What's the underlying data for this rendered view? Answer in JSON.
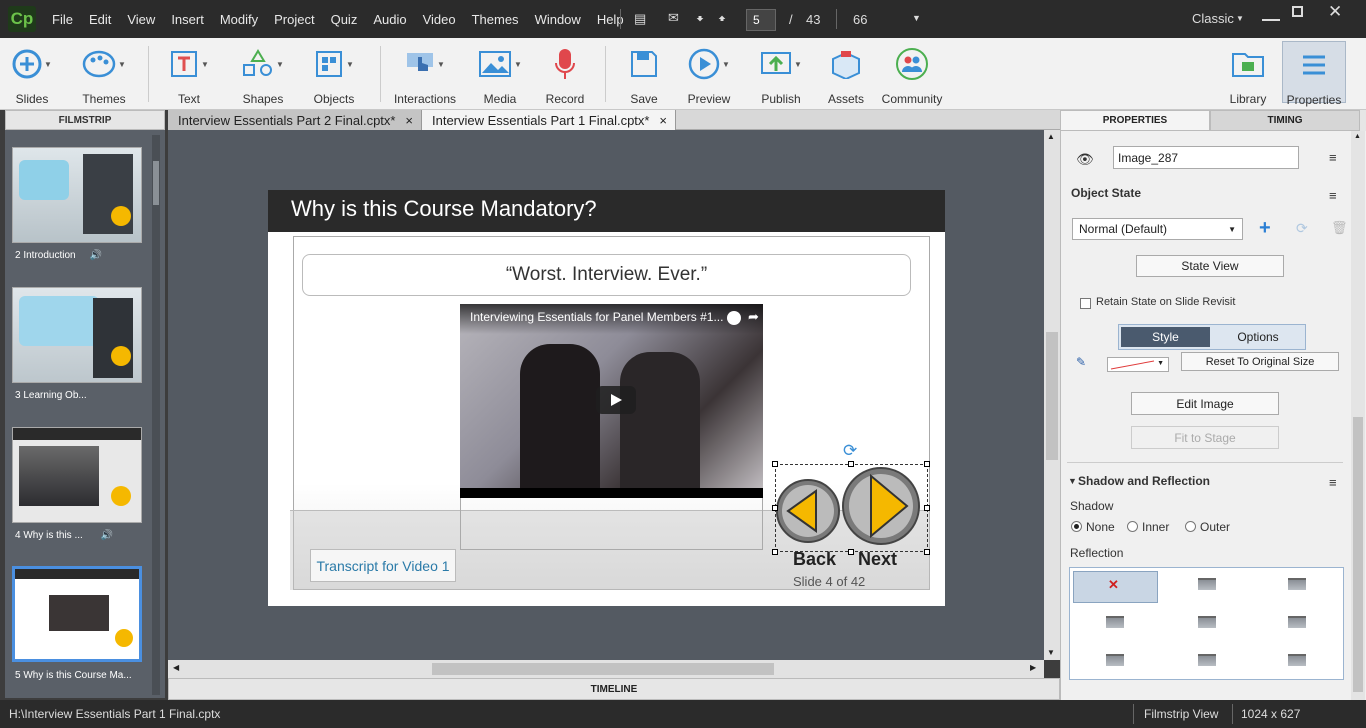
{
  "menu": [
    "File",
    "Edit",
    "View",
    "Insert",
    "Modify",
    "Project",
    "Quiz",
    "Audio",
    "Video",
    "Themes",
    "Window",
    "Help"
  ],
  "logo": "Cp",
  "nav": {
    "current_slide": "5",
    "separator": "/",
    "total_slides": "43",
    "zoom": "66"
  },
  "workspace": "Classic",
  "toolbar": [
    "Slides",
    "Themes",
    "Text",
    "Shapes",
    "Objects",
    "Interactions",
    "Media",
    "Record",
    "Save",
    "Preview",
    "Publish",
    "Assets",
    "Community"
  ],
  "toolbar_right": [
    "Library",
    "Properties"
  ],
  "filmstrip": {
    "header": "FILMSTRIP",
    "slides": [
      {
        "label": "2 Introduction"
      },
      {
        "label": "3 Learning Ob..."
      },
      {
        "label": "4 Why is this ..."
      },
      {
        "label": "5 Why is this Course Ma..."
      }
    ]
  },
  "doc_tabs": [
    {
      "title": "Interview Essentials Part 2 Final.cptx*"
    },
    {
      "title": "Interview Essentials Part 1 Final.cptx*"
    }
  ],
  "slide": {
    "title": "Why is this Course Mandatory?",
    "quote": "“Worst. Interview. Ever.”",
    "video_title": "Interviewing Essentials for Panel Members #1...",
    "transcript_button": "Transcript for Video 1",
    "back_label": "Back",
    "next_label": "Next",
    "slide_counter": "Slide 4 of 42"
  },
  "timeline": "TIMELINE",
  "properties": {
    "tab_properties": "PROPERTIES",
    "tab_timing": "TIMING",
    "object_name": "Image_287",
    "object_state_label": "Object State",
    "state_value": "Normal (Default)",
    "state_view_button": "State View",
    "retain_state": "Retain State on Slide Revisit",
    "style_tab": "Style",
    "options_tab": "Options",
    "reset_button": "Reset To Original Size",
    "edit_image_button": "Edit Image",
    "fit_to_stage_button": "Fit to Stage",
    "shadow_reflection_header": "Shadow and Reflection",
    "shadow_label": "Shadow",
    "shadow_options": [
      "None",
      "Inner",
      "Outer"
    ],
    "reflection_label": "Reflection"
  },
  "status": {
    "path": "H:\\Interview Essentials Part 1 Final.cptx",
    "view": "Filmstrip View",
    "size": "1024 x 627"
  },
  "colors": {
    "accent": "#4a8fe0",
    "play_arrow": "#f5b800",
    "logo": "#6cc24a"
  }
}
